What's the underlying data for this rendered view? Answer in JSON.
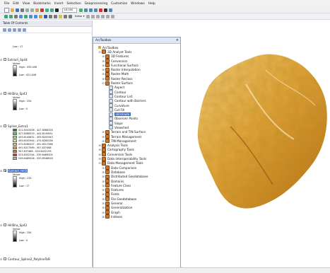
{
  "menubar": [
    "File",
    "Edit",
    "View",
    "Bookmarks",
    "Insert",
    "Selection",
    "Geoprocessing",
    "Customize",
    "Windows",
    "Help"
  ],
  "toolbar": {
    "scale": "1:8,000",
    "editor": "Editor ▾"
  },
  "toc": {
    "title": "Table Of Contents",
    "layers": [
      {
        "name": "",
        "low": "Low : 17"
      },
      {
        "name": "Extract_Sp44",
        "value": "Value",
        "high": "High : 555.456",
        "low": "Low : 421.448"
      },
      {
        "name": "HillSha_Sp43",
        "value": "Value",
        "high": "High : 254",
        "low": "Low : 0"
      },
      {
        "name": "Spline_Extra1",
        "legend": [
          "411.8033306 - 427.8088316",
          "427.8088319 - 443.8145631",
          "443.8145632 - 459.8202943",
          "459.8202944 - 475.8260256",
          "475.8260257 - 491.8317568",
          "491.8317569 - 507.837488",
          "507.837488 - 523.8432193",
          "523.8432194 - 539.8489505",
          "539.8489506 - 555.8546818"
        ]
      },
      {
        "name": "Extract_Hill3",
        "value": "Value",
        "high": "High : 233",
        "low": "Low : 17"
      },
      {
        "name": "HillSha_Sp42",
        "value": "Value",
        "high": "High : 254",
        "low": "Low : 0"
      },
      {
        "name": "Contour_Spline2_PolylineToR"
      }
    ]
  },
  "arctoolbox": {
    "title": "ArcToolbox",
    "items": [
      {
        "label": "ArcToolbox",
        "depth": 0,
        "tog": "",
        "icon": "folder"
      },
      {
        "label": "3D Analyst Tools",
        "depth": 1,
        "tog": "⊟",
        "icon": "box-i"
      },
      {
        "label": "3D Features",
        "depth": 2,
        "tog": "⊞",
        "icon": "box-i"
      },
      {
        "label": "Conversion",
        "depth": 2,
        "tog": "⊞",
        "icon": "box-i"
      },
      {
        "label": "Functional Surface",
        "depth": 2,
        "tog": "⊞",
        "icon": "box-i"
      },
      {
        "label": "Raster Interpolation",
        "depth": 2,
        "tog": "⊞",
        "icon": "box-i"
      },
      {
        "label": "Raster Math",
        "depth": 2,
        "tog": "⊞",
        "icon": "box-i"
      },
      {
        "label": "Raster Reclass",
        "depth": 2,
        "tog": "⊞",
        "icon": "box-i"
      },
      {
        "label": "Raster Surface",
        "depth": 2,
        "tog": "⊟",
        "icon": "box-i"
      },
      {
        "label": "Aspect",
        "depth": 3,
        "tog": "",
        "icon": "tool-i"
      },
      {
        "label": "Contour",
        "depth": 3,
        "tog": "",
        "icon": "tool-i"
      },
      {
        "label": "Contour List",
        "depth": 3,
        "tog": "",
        "icon": "tool-i"
      },
      {
        "label": "Contour with Barriers",
        "depth": 3,
        "tog": "",
        "icon": "tool-i"
      },
      {
        "label": "Curvature",
        "depth": 3,
        "tog": "",
        "icon": "tool-i"
      },
      {
        "label": "Cut Fill",
        "depth": 3,
        "tog": "",
        "icon": "tool-i"
      },
      {
        "label": "Hillshade",
        "depth": 3,
        "tog": "",
        "icon": "tool-i",
        "selected": true
      },
      {
        "label": "Observer Points",
        "depth": 3,
        "tog": "",
        "icon": "tool-i"
      },
      {
        "label": "Slope",
        "depth": 3,
        "tog": "",
        "icon": "tool-i"
      },
      {
        "label": "Viewshed",
        "depth": 3,
        "tog": "",
        "icon": "tool-i"
      },
      {
        "label": "Terrain and TIN Surface",
        "depth": 2,
        "tog": "⊞",
        "icon": "box-i"
      },
      {
        "label": "Terrain Management",
        "depth": 2,
        "tog": "⊞",
        "icon": "box-i"
      },
      {
        "label": "TIN Management",
        "depth": 2,
        "tog": "⊞",
        "icon": "box-i"
      },
      {
        "label": "Analysis Tools",
        "depth": 1,
        "tog": "⊞",
        "icon": "box-i"
      },
      {
        "label": "Cartography Tools",
        "depth": 1,
        "tog": "⊞",
        "icon": "box-i"
      },
      {
        "label": "Conversion Tools",
        "depth": 1,
        "tog": "⊞",
        "icon": "box-i"
      },
      {
        "label": "Data Interoperability Tools",
        "depth": 1,
        "tog": "⊞",
        "icon": "box-i"
      },
      {
        "label": "Data Management Tools",
        "depth": 1,
        "tog": "⊟",
        "icon": "box-i"
      },
      {
        "label": "Data Comparison",
        "depth": 2,
        "tog": "⊞",
        "icon": "box-i"
      },
      {
        "label": "Database",
        "depth": 2,
        "tog": "⊞",
        "icon": "box-i"
      },
      {
        "label": "Distributed Geodatabase",
        "depth": 2,
        "tog": "⊞",
        "icon": "box-i"
      },
      {
        "label": "Domains",
        "depth": 2,
        "tog": "⊞",
        "icon": "box-i"
      },
      {
        "label": "Feature Class",
        "depth": 2,
        "tog": "⊞",
        "icon": "box-i"
      },
      {
        "label": "Features",
        "depth": 2,
        "tog": "⊞",
        "icon": "box-i"
      },
      {
        "label": "Fields",
        "depth": 2,
        "tog": "⊞",
        "icon": "box-i"
      },
      {
        "label": "File Geodatabase",
        "depth": 2,
        "tog": "⊞",
        "icon": "box-i"
      },
      {
        "label": "General",
        "depth": 2,
        "tog": "⊞",
        "icon": "box-i"
      },
      {
        "label": "Generalization",
        "depth": 2,
        "tog": "⊞",
        "icon": "box-i"
      },
      {
        "label": "Graph",
        "depth": 2,
        "tog": "⊞",
        "icon": "box-i"
      },
      {
        "label": "Indexes",
        "depth": 2,
        "tog": "⊞",
        "icon": "box-i"
      }
    ]
  },
  "colors": {
    "legend": [
      "#2e7d32",
      "#66bb6a",
      "#a5d6a7",
      "#f1e79a",
      "#f3c06b",
      "#e89a4d",
      "#d8683a",
      "#c43c2a",
      "#b0b0b0"
    ]
  }
}
